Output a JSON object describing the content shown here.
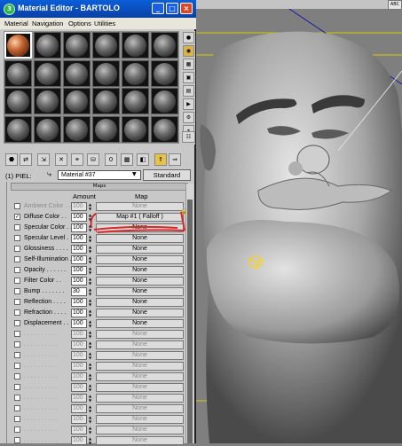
{
  "window": {
    "title": "Material Editor - BARTOLO",
    "title_icon": "3ds-max-icon",
    "controls": [
      "minimize",
      "maximize",
      "close"
    ],
    "accent": "#0a4fc0"
  },
  "menubar": [
    "Material",
    "Navigation",
    "Options",
    "Utilities"
  ],
  "slots": {
    "rows": 4,
    "cols": 6,
    "active_index": 0,
    "active_color": "#c0622e"
  },
  "right_toolbar": [
    "sample-type-icon",
    "backlight-icon",
    "background-icon",
    "uv-tiling-icon",
    "video-color-check-icon",
    "make-preview-icon",
    "options-icon",
    "select-by-material-icon",
    "material-navigator-icon"
  ],
  "bottom_toolbar": [
    "get-material-icon",
    "put-to-scene-icon",
    "assign-to-selection-icon",
    "reset-icon",
    "make-unique-icon",
    "put-to-library-icon",
    "material-id-icon",
    "show-map-icon",
    "show-end-result-icon",
    "go-to-parent-icon",
    "go-forward-icon"
  ],
  "material": {
    "label": "(1) PIEL:",
    "name": "Material #37",
    "type_button": "Standard"
  },
  "maps_rollout": {
    "header": "Maps",
    "col_amount": "Amount",
    "col_map": "Map",
    "rows": [
      {
        "label": "Ambient Color . .",
        "checked": false,
        "amount": "100",
        "map": "None",
        "disabled": true
      },
      {
        "label": "Diffuse Color . .",
        "checked": true,
        "amount": "100",
        "map": "Map #1  ( Falloff )",
        "disabled": false
      },
      {
        "label": "Specular Color . .",
        "checked": false,
        "amount": "100",
        "map": "None",
        "disabled": false
      },
      {
        "label": "Specular Level .",
        "checked": false,
        "amount": "100",
        "map": "None",
        "disabled": false
      },
      {
        "label": "Glossiness . . . .",
        "checked": false,
        "amount": "100",
        "map": "None",
        "disabled": false
      },
      {
        "label": "Self-Illumination .",
        "checked": false,
        "amount": "100",
        "map": "None",
        "disabled": false
      },
      {
        "label": "Opacity . . . . . .",
        "checked": false,
        "amount": "100",
        "map": "None",
        "disabled": false
      },
      {
        "label": "Filter Color . .",
        "checked": false,
        "amount": "100",
        "map": "None",
        "disabled": false
      },
      {
        "label": "Bump . . . . . . .",
        "checked": false,
        "amount": "30",
        "map": "None",
        "disabled": false
      },
      {
        "label": "Reflection . . . .",
        "checked": false,
        "amount": "100",
        "map": "None",
        "disabled": false
      },
      {
        "label": "Refraction . . . .",
        "checked": false,
        "amount": "100",
        "map": "None",
        "disabled": false
      },
      {
        "label": "Displacement . .",
        "checked": false,
        "amount": "100",
        "map": "None",
        "disabled": false
      },
      {
        "label": ". . . . . . . . . .",
        "checked": false,
        "amount": "100",
        "map": "None",
        "disabled": true
      },
      {
        "label": ". . . . . . . . . .",
        "checked": false,
        "amount": "100",
        "map": "None",
        "disabled": true
      },
      {
        "label": ". . . . . . . . . .",
        "checked": false,
        "amount": "100",
        "map": "None",
        "disabled": true
      },
      {
        "label": ". . . . . . . . . .",
        "checked": false,
        "amount": "100",
        "map": "None",
        "disabled": true
      },
      {
        "label": ". . . . . . . . . .",
        "checked": false,
        "amount": "100",
        "map": "None",
        "disabled": true
      },
      {
        "label": ". . . . . . . . . .",
        "checked": false,
        "amount": "100",
        "map": "None",
        "disabled": true
      },
      {
        "label": ". . . . . . . . . .",
        "checked": false,
        "amount": "100",
        "map": "None",
        "disabled": true
      },
      {
        "label": ". . . . . . . . . .",
        "checked": false,
        "amount": "100",
        "map": "None",
        "disabled": true
      },
      {
        "label": ". . . . . . . . . .",
        "checked": false,
        "amount": "100",
        "map": "None",
        "disabled": true
      },
      {
        "label": ". . . . . . . . . .",
        "checked": false,
        "amount": "100",
        "map": "None",
        "disabled": true
      },
      {
        "label": ". . . . . . . . . .",
        "checked": false,
        "amount": "100",
        "map": "None",
        "disabled": true
      }
    ]
  },
  "annotation_color": "#d42a2a",
  "viewport": {
    "bg": "#7f7f7f",
    "tabs": [
      "ABC"
    ]
  }
}
